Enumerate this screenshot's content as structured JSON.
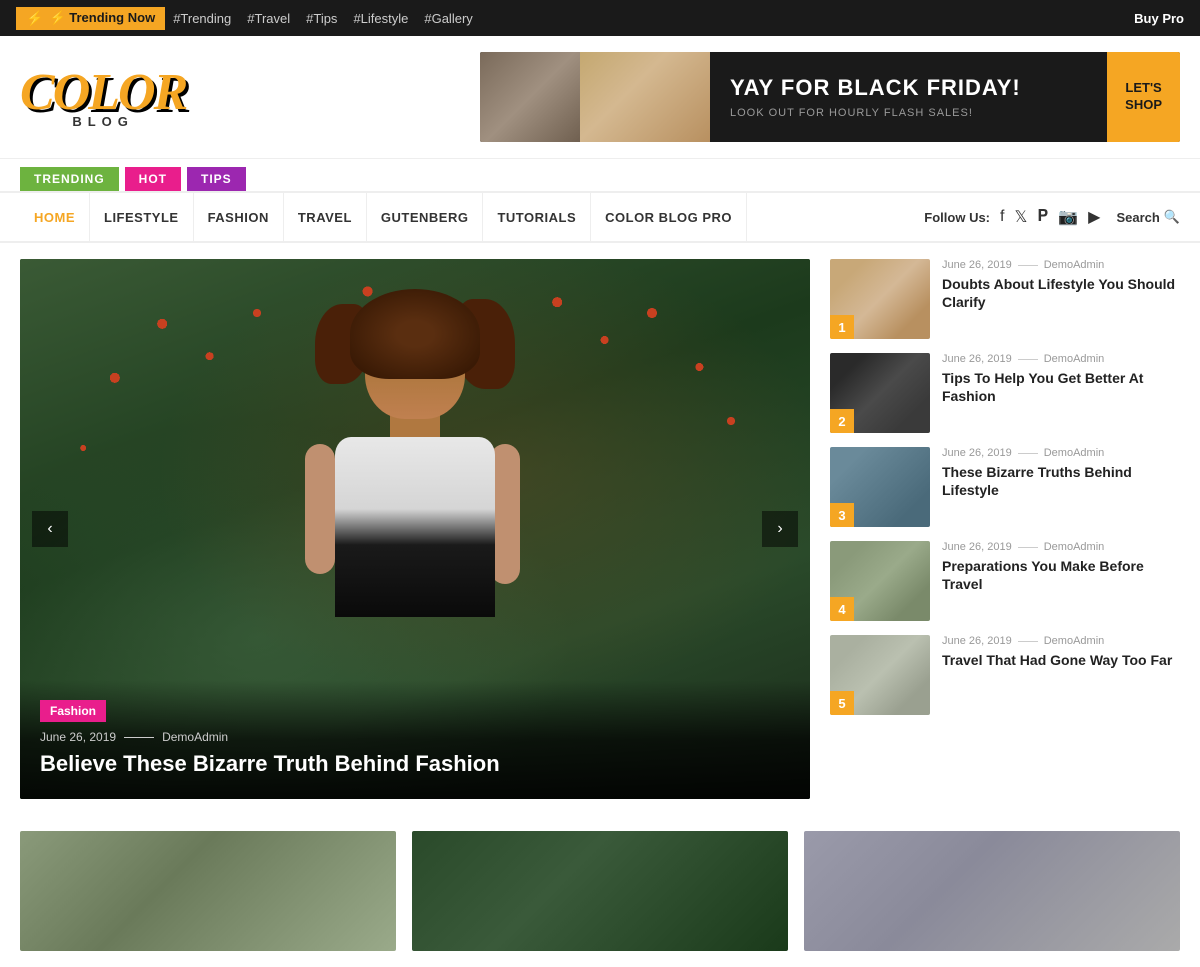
{
  "topbar": {
    "trending_label": "⚡ Trending Now",
    "hashtags": [
      "#Trending",
      "#Travel",
      "#Tips",
      "#Lifestyle",
      "#Gallery"
    ],
    "buy_pro": "Buy Pro"
  },
  "logo": {
    "color": "COLOR",
    "blog": "BLOG"
  },
  "banner": {
    "headline": "YAY FOR BLACK FRIDAY!",
    "subtext": "LOOK OUT FOR HOURLY FLASH SALES!",
    "cta": "LET'S\nSHOP"
  },
  "tabs": [
    {
      "label": "TRENDING",
      "class": "trending"
    },
    {
      "label": "HOT",
      "class": "hot"
    },
    {
      "label": "TIPS",
      "class": "tips"
    }
  ],
  "nav": {
    "links": [
      {
        "label": "HOME",
        "active": true
      },
      {
        "label": "LIFESTYLE",
        "active": false
      },
      {
        "label": "FASHION",
        "active": false
      },
      {
        "label": "TRAVEL",
        "active": false
      },
      {
        "label": "GUTENBERG",
        "active": false
      },
      {
        "label": "TUTORIALS",
        "active": false
      },
      {
        "label": "COLOR BLOG PRO",
        "active": false
      }
    ],
    "follow_label": "Follow Us:",
    "search_label": "Search"
  },
  "hero": {
    "category": "Fashion",
    "date": "June 26, 2019",
    "author": "DemoAdmin",
    "title": "Believe These Bizarre Truth Behind Fashion"
  },
  "sidebar_items": [
    {
      "num": "1",
      "date": "June 26, 2019",
      "author": "DemoAdmin",
      "title": "Doubts About Lifestyle You Should Clarify",
      "thumb_class": "sidebar-thumb-1"
    },
    {
      "num": "2",
      "date": "June 26, 2019",
      "author": "DemoAdmin",
      "title": "Tips To Help You Get Better At Fashion",
      "thumb_class": "sidebar-thumb-2"
    },
    {
      "num": "3",
      "date": "June 26, 2019",
      "author": "DemoAdmin",
      "title": "These Bizarre Truths Behind Lifestyle",
      "thumb_class": "sidebar-thumb-3"
    },
    {
      "num": "4",
      "date": "June 26, 2019",
      "author": "DemoAdmin",
      "title": "Preparations You Make Before Travel",
      "thumb_class": "sidebar-thumb-4"
    },
    {
      "num": "5",
      "date": "June 26, 2019",
      "author": "DemoAdmin",
      "title": "Travel That Had Gone Way Too Far",
      "thumb_class": "sidebar-thumb-5"
    }
  ]
}
